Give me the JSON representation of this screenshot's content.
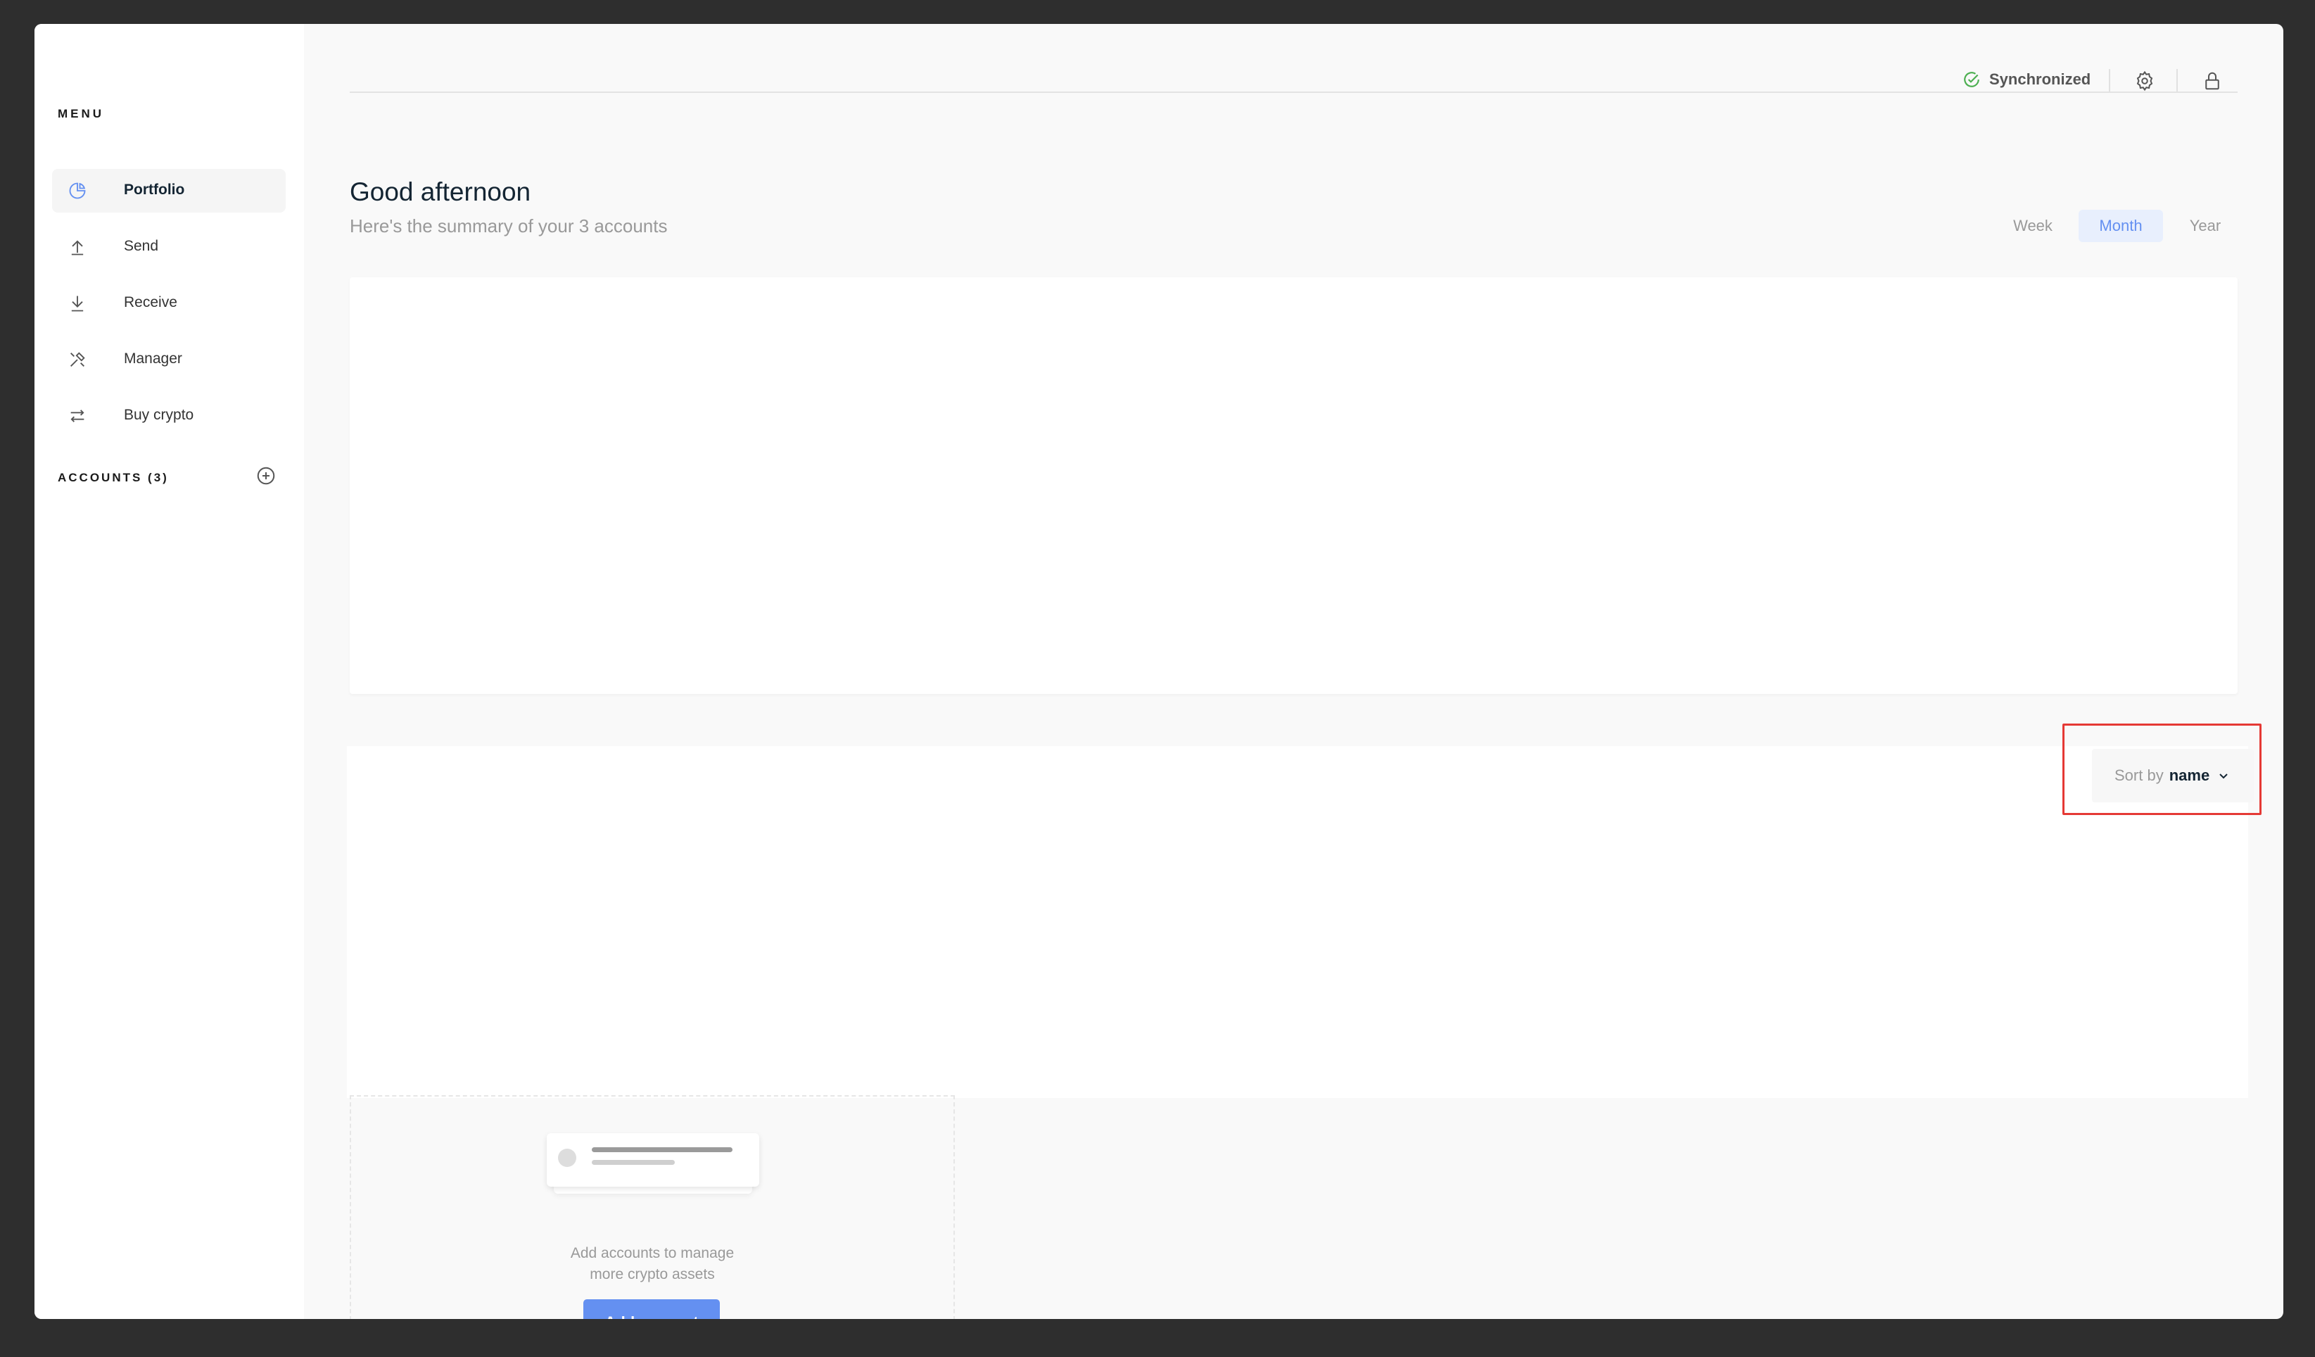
{
  "sidebar": {
    "menu_title": "MENU",
    "items": [
      {
        "label": "Portfolio",
        "icon": "portfolio-icon",
        "active": true
      },
      {
        "label": "Send",
        "icon": "send-icon"
      },
      {
        "label": "Receive",
        "icon": "receive-icon"
      },
      {
        "label": "Manager",
        "icon": "manager-icon"
      },
      {
        "label": "Buy crypto",
        "icon": "buy-crypto-icon"
      }
    ],
    "accounts_title": "ACCOUNTS (3)"
  },
  "topbar": {
    "sync_label": "Synchronized",
    "sync_color": "#4caf50"
  },
  "header": {
    "greeting": "Good afternoon",
    "summary": "Here's the summary of your 3 accounts"
  },
  "periods": {
    "week": "Week",
    "month": "Month",
    "year": "Year",
    "selected": "Month"
  },
  "sort": {
    "prefix": "Sort by",
    "value": "name"
  },
  "empty_state": {
    "text_line1": "Add accounts to manage",
    "text_line2": "more crypto assets",
    "button_label": "Add account"
  },
  "colors": {
    "accent": "#6490f1",
    "highlight": "#e53935"
  }
}
